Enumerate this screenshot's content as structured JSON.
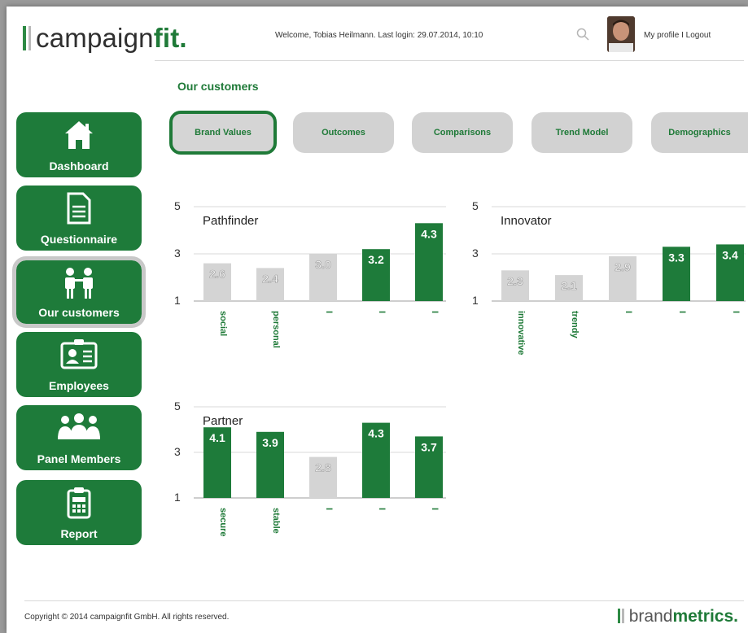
{
  "header": {
    "logo_main": "campaign",
    "logo_accent": "fit.",
    "welcome": "Welcome, Tobias Heilmann. Last login: 29.07.2014, 10:10",
    "profile_links": "My profile I Logout"
  },
  "page": {
    "title": "Our customers"
  },
  "sidebar": {
    "items": [
      {
        "label": "Dashboard",
        "icon": "home-icon"
      },
      {
        "label": "Questionnaire",
        "icon": "document-icon"
      },
      {
        "label": "Our customers",
        "icon": "people-icon"
      },
      {
        "label": "Employees",
        "icon": "id-card-icon"
      },
      {
        "label": "Panel Members",
        "icon": "group-icon"
      },
      {
        "label": "Report",
        "icon": "clipboard-icon"
      }
    ]
  },
  "tabs": [
    {
      "label": "Brand Values"
    },
    {
      "label": "Outcomes"
    },
    {
      "label": "Comparisons"
    },
    {
      "label": "Trend Model"
    },
    {
      "label": "Demographics"
    }
  ],
  "colors": {
    "green": "#1e7b3a",
    "grey": "#d4d4d4",
    "accent_text": "#1f7a38"
  },
  "chart_data": [
    {
      "type": "bar",
      "title": "Pathfinder",
      "ylim": [
        1,
        5
      ],
      "yticks": [
        "1",
        "3",
        "5"
      ],
      "categories": [
        "social",
        "personal",
        "I",
        "I",
        "I"
      ],
      "values": [
        2.6,
        2.4,
        3.0,
        3.2,
        4.3
      ],
      "value_labels": [
        "2.6",
        "2.4",
        "3.0",
        "3.2",
        "4.3"
      ],
      "highlight": [
        false,
        false,
        false,
        true,
        true
      ]
    },
    {
      "type": "bar",
      "title": "Innovator",
      "ylim": [
        1,
        5
      ],
      "yticks": [
        "1",
        "3",
        "5"
      ],
      "categories": [
        "innovative",
        "trendy",
        "I",
        "I",
        "I"
      ],
      "values": [
        2.3,
        2.1,
        2.9,
        3.3,
        3.4
      ],
      "value_labels": [
        "2.3",
        "2.1",
        "2.9",
        "3.3",
        "3.4"
      ],
      "highlight": [
        false,
        false,
        false,
        true,
        true
      ]
    },
    {
      "type": "bar",
      "title": "Partner",
      "ylim": [
        1,
        5
      ],
      "yticks": [
        "1",
        "3",
        "5"
      ],
      "categories": [
        "secure",
        "stable",
        "I",
        "I",
        "I"
      ],
      "values": [
        4.1,
        3.9,
        2.8,
        4.3,
        3.7
      ],
      "value_labels": [
        "4.1",
        "3.9",
        "2.8",
        "4.3",
        "3.7"
      ],
      "highlight": [
        true,
        true,
        false,
        true,
        true
      ]
    }
  ],
  "footer": {
    "copyright": "Copyright © 2014 campaignfit GmbH. All rights reserved.",
    "brand_main": "brand",
    "brand_accent": "metrics."
  }
}
